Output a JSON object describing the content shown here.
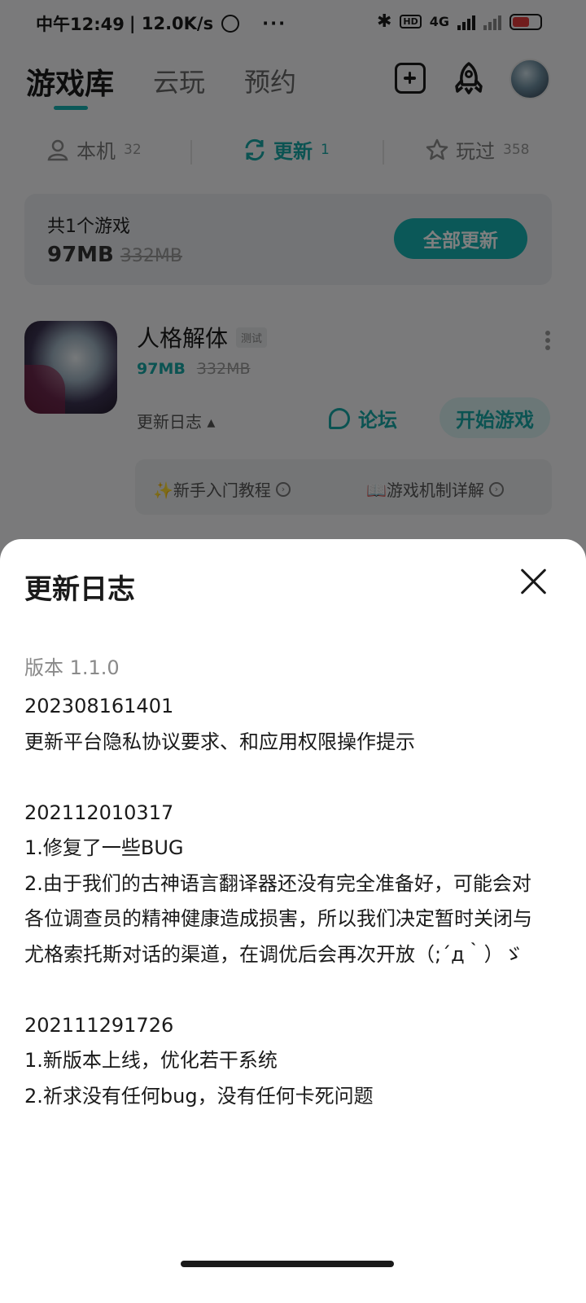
{
  "status_bar": {
    "time": "中午12:49",
    "speed": "| 12.0K/s",
    "dots": "···",
    "bluetooth": "✱",
    "hd": "HD",
    "network": "4G",
    "icons": [
      "alarm-icon",
      "bluetooth-icon",
      "hd-icon",
      "signal-icon",
      "signal-off-icon",
      "battery-icon"
    ]
  },
  "header": {
    "tabs": [
      "游戏库",
      "云玩",
      "预约"
    ],
    "active_tab": "游戏库",
    "accent": "#17b1b0"
  },
  "subtabs": [
    {
      "label": "本机",
      "count": "32"
    },
    {
      "label": "更新",
      "count": "1"
    },
    {
      "label": "玩过",
      "count": "358"
    }
  ],
  "summary": {
    "count_text": "共1个游戏",
    "size": "97MB",
    "size_old": "332MB",
    "update_all_label": "全部更新"
  },
  "game": {
    "title": "人格解体",
    "tag": "测试",
    "size": "97MB",
    "size_old": "332MB",
    "changelog_label": "更新日志 ▴",
    "forum_label": "论坛",
    "play_label": "开始游戏",
    "guide_1": "✨新手入门教程",
    "guide_2": "📖游戏机制详解",
    "guide_arrow": "›"
  },
  "sheet": {
    "title": "更新日志",
    "version": "版本 1.1.0",
    "entries": [
      {
        "id": "202308161401",
        "lines": [
          "更新平台隐私协议要求、和应用权限操作提示"
        ]
      },
      {
        "id": "202112010317",
        "lines": [
          "1.修复了一些BUG",
          "2.由于我们的古神语言翻译器还没有完全准备好，可能会对各位调查员的精神健康造成损害，所以我们决定暂时关闭与尤格索托斯对话的渠道，在调优后会再次开放（;´д｀）ゞ"
        ]
      },
      {
        "id": "202111291726",
        "lines": [
          "1.新版本上线，优化若干系统",
          "2.祈求没有任何bug，没有任何卡死问题"
        ]
      }
    ]
  }
}
